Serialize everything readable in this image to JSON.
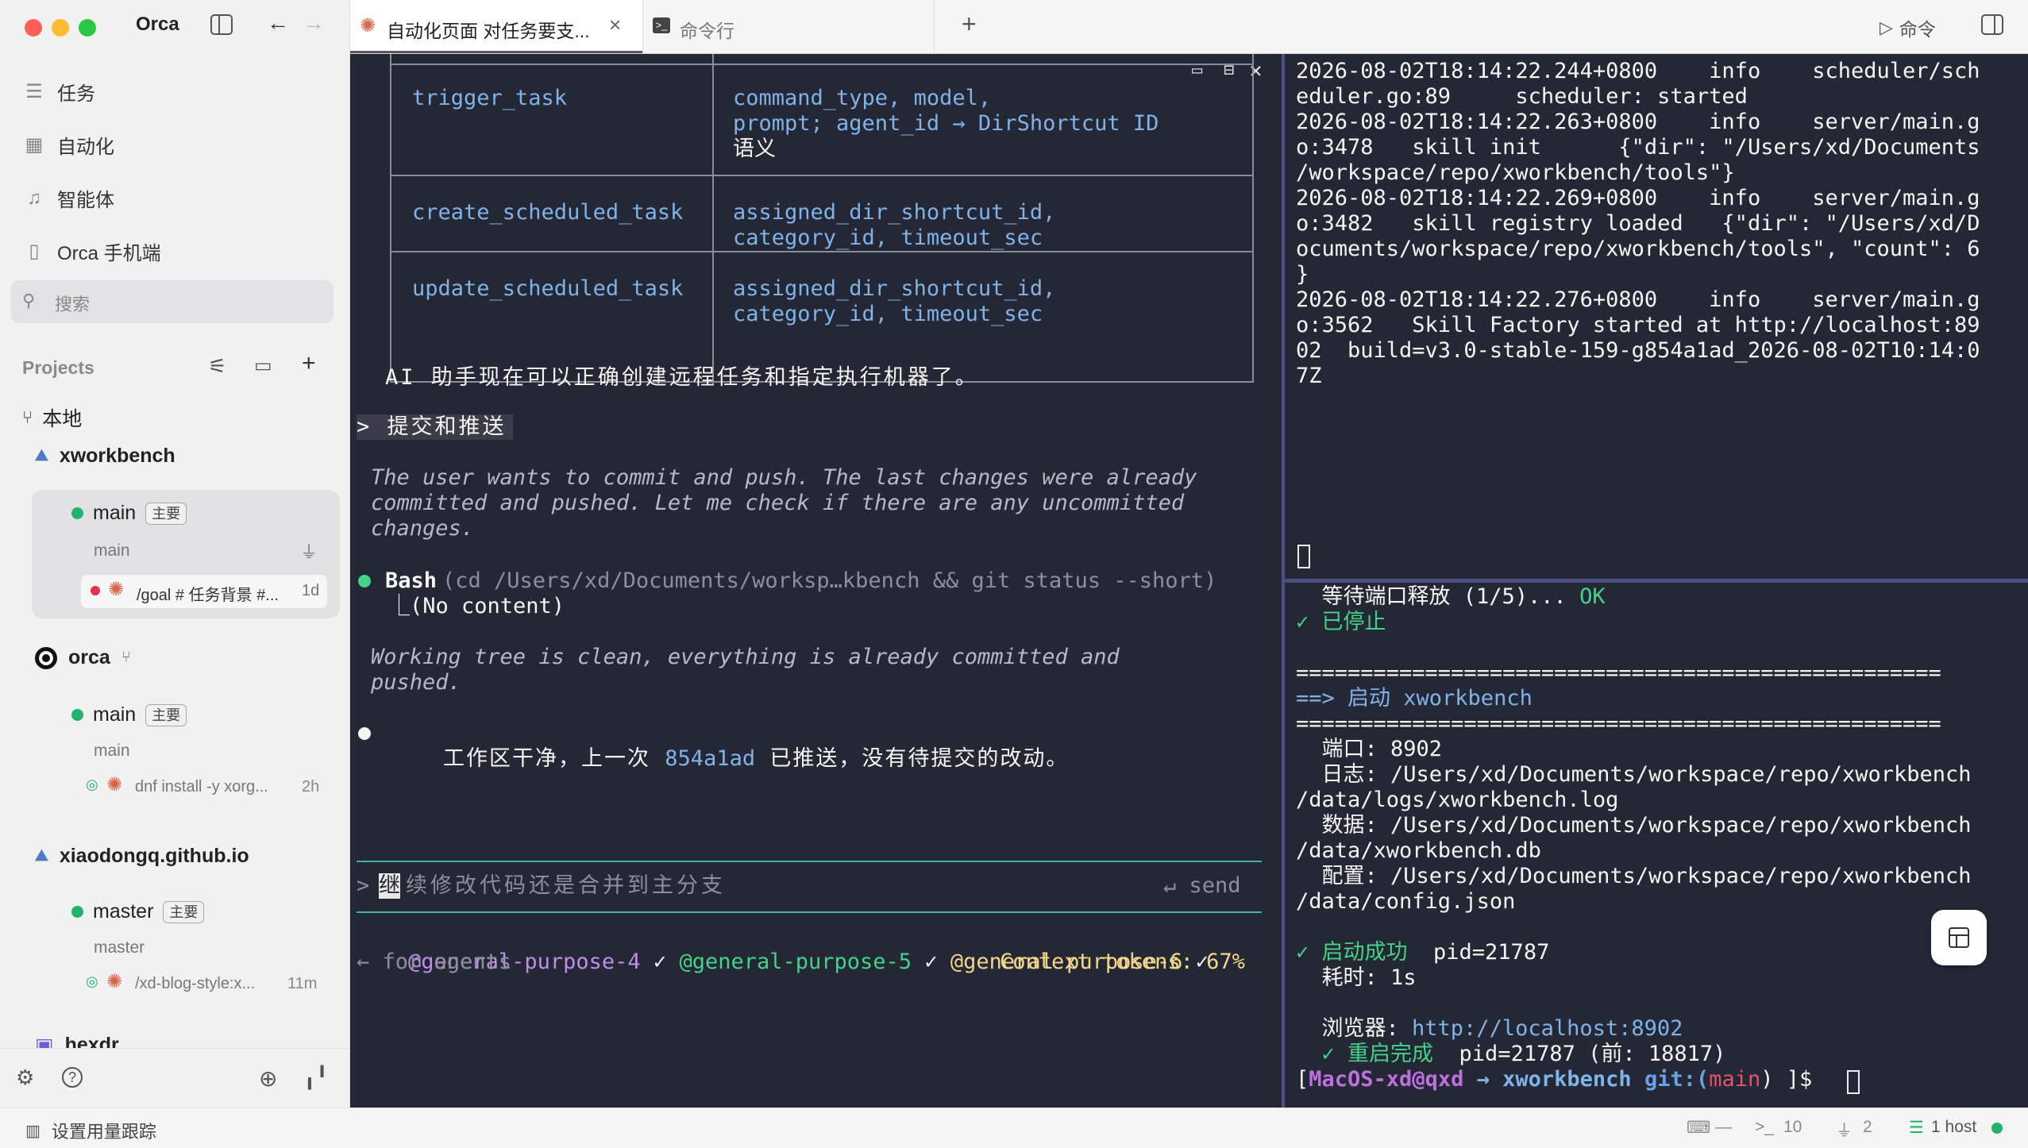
{
  "app": {
    "name": "Orca"
  },
  "sidebar": {
    "nav": [
      {
        "label": "任务",
        "icon": "list-icon"
      },
      {
        "label": "自动化",
        "icon": "calendar-clock-icon"
      },
      {
        "label": "智能体",
        "icon": "bell-icon"
      },
      {
        "label": "Orca 手机端",
        "icon": "phone-icon"
      }
    ],
    "search_placeholder": "搜索",
    "projects_label": "Projects",
    "local_label": "本地",
    "projects": [
      {
        "name": "xworkbench",
        "branch": "main",
        "badge": "主要",
        "sub": "main",
        "task": "/goal # 任务背景 #...",
        "task_time": "1d"
      },
      {
        "name": "orca",
        "branch": "main",
        "badge": "主要",
        "sub": "main",
        "task": "dnf install -y xorg...",
        "task_time": "2h"
      },
      {
        "name": "xiaodongq.github.io",
        "branch": "master",
        "badge": "主要",
        "sub": "master",
        "task": "/xd-blog-style:x...",
        "task_time": "11m"
      },
      {
        "name": "hexdr"
      }
    ]
  },
  "tabs": [
    {
      "label": "自动化页面 对任务要支...",
      "active": true
    },
    {
      "label": "命令行",
      "active": false
    }
  ],
  "topbar": {
    "command_label": "命令"
  },
  "left_terminal": {
    "table": [
      {
        "name": "trigger_task",
        "desc1": "command_type, model,",
        "desc2a": "prompt; agent_id → DirShortcut ID",
        "desc3": "语义"
      },
      {
        "name": "create_scheduled_task",
        "desc1": "assigned_dir_shortcut_id,",
        "desc2": "category_id, timeout_sec"
      },
      {
        "name": "update_scheduled_task",
        "desc1": "assigned_dir_shortcut_id,",
        "desc2": "category_id, timeout_sec"
      }
    ],
    "summary": "AI 助手现在可以正确创建远程任务和指定执行机器了。",
    "prompt_cmd": "> 提交和推送",
    "thinking1": "The user wants to commit and push. The last changes were already",
    "thinking2": "committed and pushed. Let me check if there are any uncommitted",
    "thinking3": "changes.",
    "tool_name": "Bash",
    "tool_args": "(cd /Users/xd/Documents/worksp…kbench && git status --short)",
    "tool_result": "⎿(No content)",
    "thinking4": "Working tree is clean, everything is already committed and",
    "thinking5": "pushed.",
    "final_pre": "工作区干净，上一次 ",
    "final_hash": "854a1ad",
    "final_post": " 已推送，没有待提交的改动。",
    "input_prompt": ">",
    "input_first": "继",
    "input_text": "续修改代码还是合并到主分支",
    "send_label": "↵ send",
    "agent1": "@general-purpose-4",
    "agent2": "@general-purpose-5",
    "agent3": "@general-purpose-6",
    "check": "✓",
    "agents_hint": "← for agents",
    "context": "Context tokens: 67%"
  },
  "right_top": {
    "lines": [
      "2026-08-02T18:14:22.244+0800    info    scheduler/sch",
      "eduler.go:89     scheduler: started",
      "2026-08-02T18:14:22.263+0800    info    server/main.g",
      "o:3478   skill init      {\"dir\": \"/Users/xd/Documents",
      "/workspace/repo/xworkbench/tools\"}",
      "2026-08-02T18:14:22.269+0800    info    server/main.g",
      "o:3482   skill registry loaded   {\"dir\": \"/Users/xd/D",
      "ocuments/workspace/repo/xworkbench/tools\", \"count\": 6",
      "}",
      "2026-08-02T18:14:22.276+0800    info    server/main.g",
      "o:3562   Skill Factory started at http://localhost:89",
      "02  build=v3.0-stable-159-g854a1ad_2026-08-02T10:14:0",
      "7Z"
    ]
  },
  "right_bottom": {
    "wait": "  等待端口释放 (1/5)... ",
    "ok": "OK",
    "stopped": "✓ 已停止",
    "sep": "==================================================",
    "start_label": "==> 启动 xworkbench",
    "port": "  端口: 8902",
    "log1": "  日志: /Users/xd/Documents/workspace/repo/xworkbench",
    "log2": "/data/logs/xworkbench.log",
    "data1": "  数据: /Users/xd/Documents/workspace/repo/xworkbench",
    "data2": "/data/xworkbench.db",
    "cfg1": "  配置: /Users/xd/Documents/workspace/repo/xworkbench",
    "cfg2": "/data/config.json",
    "success": "✓ 启动成功",
    "pid": "  pid=21787",
    "elapsed": "  耗时: 1s",
    "browser_label": "  浏览器: ",
    "browser_url": "http://localhost:8902",
    "restart": "  ✓ 重启完成",
    "restart_pid": "  pid=21787 (前: 18817)",
    "ps_open": "[",
    "ps_user": "MacOS-xd@qxd",
    "ps_arrow": " → ",
    "ps_dir": "xworkbench",
    "ps_git": " git:(",
    "ps_branch": "main",
    "ps_close": ") ]$ "
  },
  "statusbar": {
    "usage_label": "设置用量跟踪",
    "count1": "10",
    "count2": "2",
    "host": "1 host"
  }
}
